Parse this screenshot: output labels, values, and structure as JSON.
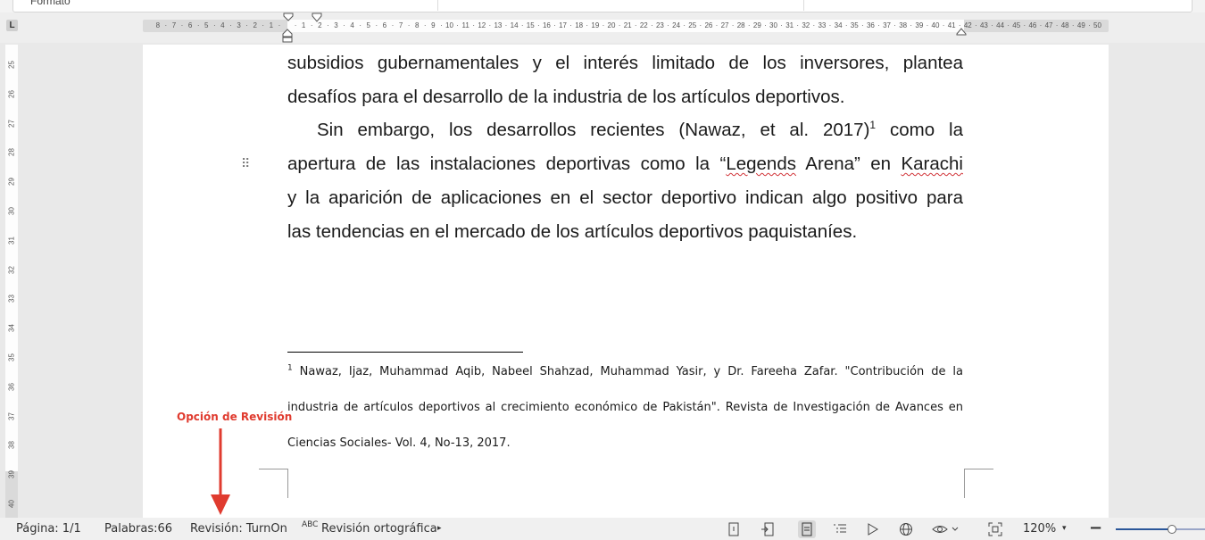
{
  "toolbar": {
    "partial_label": "Formato"
  },
  "hruler": {
    "left_ticks": [
      "8",
      "7",
      "6",
      "5",
      "4",
      "3",
      "2",
      "1"
    ],
    "right_ticks": [
      "1",
      "2",
      "3",
      "4",
      "5",
      "6",
      "7",
      "8",
      "9",
      "10",
      "11",
      "12",
      "13",
      "14",
      "15",
      "16",
      "17",
      "18",
      "19",
      "20",
      "21",
      "22",
      "23",
      "24",
      "25",
      "26",
      "27",
      "28",
      "29",
      "30",
      "31",
      "32",
      "33",
      "34",
      "35",
      "36",
      "37",
      "38",
      "39",
      "40",
      "41",
      "42",
      "43",
      "44",
      "45",
      "46",
      "47",
      "48",
      "49",
      "50"
    ]
  },
  "vruler": {
    "ticks": [
      "25",
      "26",
      "27",
      "28",
      "29",
      "30",
      "31",
      "32",
      "33",
      "34",
      "35",
      "36",
      "37",
      "38",
      "39",
      "40"
    ]
  },
  "document": {
    "para1": {
      "line1": "subsidios gubernamentales y el interés limitado de los inversores, plantea",
      "line2": "desafíos para el desarrollo de la industria de los artículos deportivos."
    },
    "para2": {
      "line1_a": "Sin embargo, los desarrollos recientes (Nawaz, et al. 2017)",
      "line1_sup": "1",
      "line1_b": " como la",
      "line2_a": "apertura de las instalaciones deportivas como la “",
      "line2_legends": "Legends",
      "line2_b": " Arena” en ",
      "line2_karachi": "Karachi",
      "line3": "y la aparición de aplicaciones en el sector deportivo indican algo positivo para",
      "line4": "las tendencias en el mercado de los artículos deportivos paquistaníes."
    },
    "footnote": {
      "number": "1",
      "line1": " Nawaz, Ijaz, Muhammad Aqib, Nabeel Shahzad, Muhammad Yasir, y Dr. Fareeha Zafar. \"Contribución de la",
      "line2": "industria de artículos deportivos al crecimiento económico de Pakistán\". Revista de Investigación de Avances en",
      "line3": "Ciencias Sociales- Vol. 4, No-13, 2017."
    }
  },
  "annotation": {
    "label": "Opción de Revisión",
    "color": "#e03b2f"
  },
  "statusbar": {
    "page": "Página: 1/1",
    "words": "Palabras:66",
    "revision": "Revisión: TurnOn",
    "spell_icon_text": "ABC",
    "spell": "Revisión ortográfica",
    "zoom": "120%",
    "zoom_level_fraction": 0.62
  },
  "colors": {
    "spell_underline": "#d13438",
    "zoom_slider": "#2b579a"
  }
}
